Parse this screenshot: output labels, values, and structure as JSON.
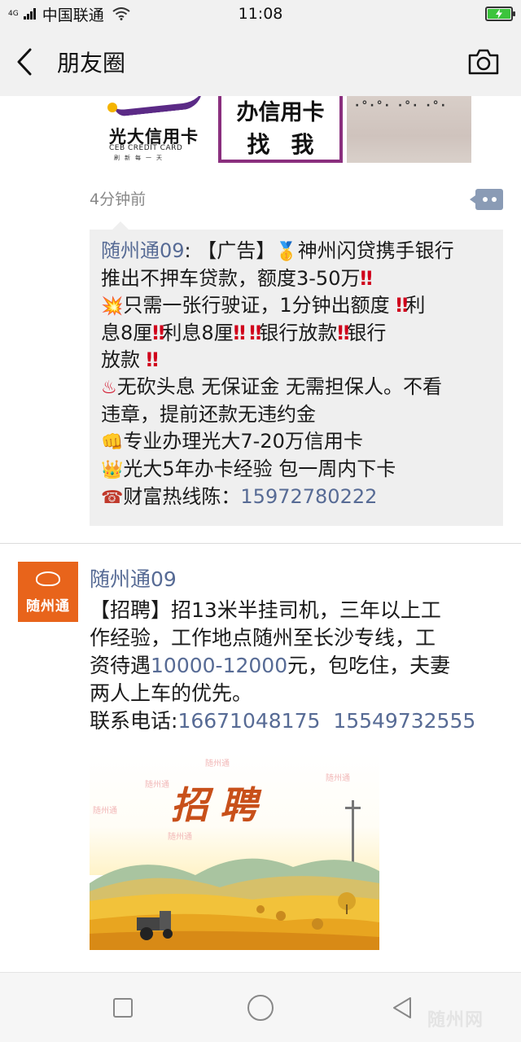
{
  "status_bar": {
    "network_type": "4G",
    "carrier": "中国联通",
    "time": "11:08",
    "battery_charging": true,
    "battery_level": 1.0
  },
  "nav": {
    "title": "朋友圈",
    "back_icon": "chevron-left-icon",
    "camera_icon": "camera-icon"
  },
  "previous_post": {
    "images": [
      {
        "brand": "光大信用卡",
        "brand_en": "CEB CREDIT CARD",
        "slogan": "刷新每一天"
      },
      {
        "line1": "办信用卡",
        "line2": "找我"
      },
      {
        "kind": "photo"
      }
    ],
    "time_ago": "4分钟前",
    "comment": {
      "author": "随州通09",
      "separator": ":",
      "lines": {
        "l1_a": " 【广告】",
        "l1_b": "神州闪贷携手银行",
        "l2": "推出不押车贷款，额度3-50万",
        "l3_a": "只需一张行驶证，1分钟出额度 ",
        "l3_b": "利",
        "l4_a": "息8厘",
        "l4_b": "利息8厘",
        "l4_c": "银行放款",
        "l4_d": "银行",
        "l5": "放款 ",
        "l6": "无砍头息  无保证金  无需担保人。不看",
        "l7": "违章，提前还款无违约金",
        "l8": "专业办理光大7-20万信用卡",
        "l9": "光大5年办卡经验  包一周内下卡",
        "l10_a": "财富热线陈：",
        "phone": "15972780222"
      },
      "emoji": {
        "medal": "🥇",
        "double_bang": "‼",
        "collision": "💥",
        "hot_springs": "♨",
        "fist": "👊",
        "crown": "👑",
        "telephone": "☎"
      }
    }
  },
  "post": {
    "author": "随州通09",
    "avatar_text": "随州通",
    "text": {
      "l1": "【招聘】招13米半挂司机，三年以上工",
      "l2": "作经验，工作地点随州至长沙专线，工",
      "l3_a": "资待遇",
      "salary": "10000-12000",
      "l3_b": "元，包吃住，夫妻",
      "l4": "两人上车的优先。",
      "l5_a": "联系电话:",
      "phone1": "16671048175",
      "phone_gap": "  ",
      "phone2": "15549732555"
    },
    "image": {
      "title": "招聘",
      "watermark": "随州通"
    }
  },
  "bottom_nav": {
    "buttons": [
      "recent-apps",
      "home",
      "back"
    ],
    "watermark": "随州网"
  },
  "colors": {
    "link": "#576b95",
    "comment_bg": "#efefef",
    "avatar_bg": "#e8641b",
    "bang_red": "#d0021b"
  }
}
